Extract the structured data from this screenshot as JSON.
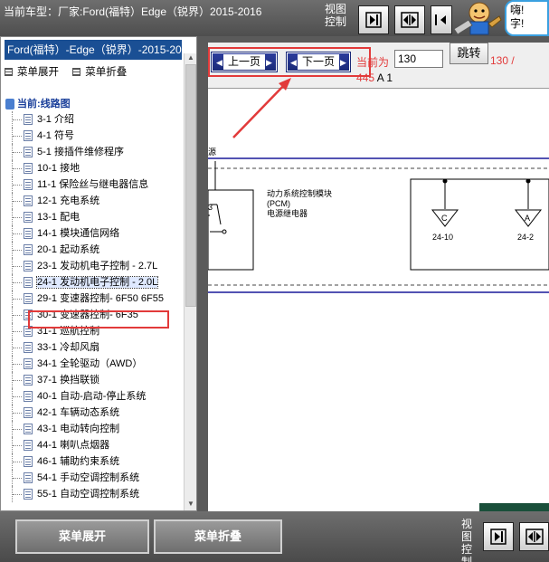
{
  "header": {
    "vehicle_title": "当前车型：厂家:Ford(福特）Edge（锐界）2015-2016",
    "view_control": "视图控制",
    "speech_text": "嗨!\n字!"
  },
  "sidebar": {
    "title": "Ford(福特）-Edge（锐界）-2015-20",
    "expand_link": "菜单展开",
    "collapse_link": "菜单折叠",
    "tree_root": "当前:线路图",
    "items": [
      {
        "label": "3-1 介绍"
      },
      {
        "label": "4-1 符号"
      },
      {
        "label": "5-1 接插件维修程序"
      },
      {
        "label": "10-1 接地"
      },
      {
        "label": "11-1 保险丝与继电器信息"
      },
      {
        "label": "12-1 充电系统"
      },
      {
        "label": "13-1 配电"
      },
      {
        "label": "14-1 模块通信网络"
      },
      {
        "label": "20-1 起动系统"
      },
      {
        "label": "23-1 发动机电子控制 - 2.7L"
      },
      {
        "label": "24-1 发动机电子控制 - 2.0L"
      },
      {
        "label": "29-1 变速器控制- 6F50 6F55"
      },
      {
        "label": "30-1 变速器控制- 6F35"
      },
      {
        "label": "31-1 巡航控制"
      },
      {
        "label": "33-1 冷却风扇"
      },
      {
        "label": "34-1 全轮驱动（AWD）"
      },
      {
        "label": "37-1 换挡联锁"
      },
      {
        "label": "40-1 自动-启动-停止系统"
      },
      {
        "label": "42-1 车辆动态系统"
      },
      {
        "label": "43-1 电动转向控制"
      },
      {
        "label": "44-1 喇叭点烟器"
      },
      {
        "label": "46-1 辅助约束系统"
      },
      {
        "label": "54-1 手动空调控制系统"
      },
      {
        "label": "55-1 自动空调控制系统"
      }
    ],
    "selected_index": 10
  },
  "navigation": {
    "prev_label": "上一页",
    "next_label": "下一页",
    "current_label": "当前为",
    "page_value": "130",
    "jump_label": "跳转",
    "total_label": "130 /",
    "sub_part1": "445",
    "sub_part2": " A 1"
  },
  "diagram": {
    "pcm_line1": "动力系统控制模块",
    "pcm_line2": "(PCM)",
    "pcm_line3": "电源继电器",
    "pin_number": "3",
    "conn_c": "C",
    "conn_a": "A",
    "conn_c_id": "24-10",
    "conn_a_id": "24-2",
    "header_fragment": "源"
  },
  "footer": {
    "expand_button": "菜单展开",
    "collapse_button": "菜单折叠",
    "view_control": "视图控制"
  },
  "colors": {
    "accent_red": "#e23a3a",
    "nav_blue": "#1a2a78",
    "title_blue": "#1a4f94",
    "bar_gray": "#5a5a5a"
  }
}
